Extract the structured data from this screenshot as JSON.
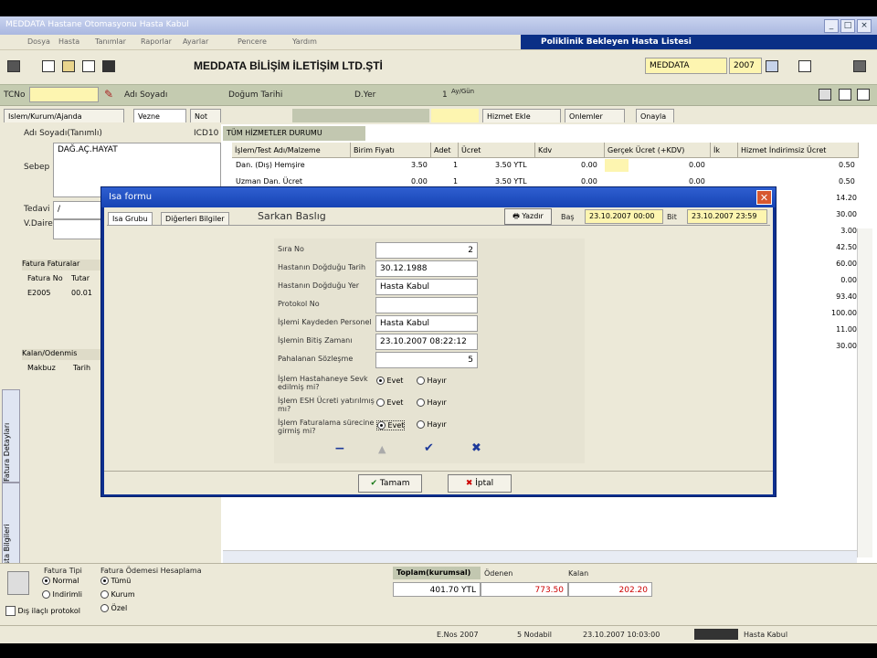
{
  "window": {
    "title": "MEDDATA Hastane Otomasyonu Hasta Kabul",
    "panel_title": "Poliklinik Bekleyen Hasta Listesi"
  },
  "menu": [
    "Dosya",
    "Hasta",
    "Tanımlar",
    "Raporlar",
    "Ayarlar",
    "Pencere",
    "Yardım"
  ],
  "toolbar": {
    "company": "MEDDATA BİLİŞİM İLETİŞİM LTD.ŞTİ",
    "db_name": "MEDDATA",
    "year": "2007"
  },
  "patientbar": {
    "tc_label": "TCNo",
    "tc_value": "",
    "name_label": "Adı Soyadı",
    "birth_label": "Doğum Tarihi",
    "age_label": "D.Yer",
    "count_label": "1",
    "count_sub": "Ay/Gün"
  },
  "tabs": {
    "main": [
      "Islem/Kurum/Ajanda",
      "Vezne",
      "Not"
    ],
    "right": [
      "Hizmet Ekle",
      "Onlemler",
      "Onayla"
    ]
  },
  "left": {
    "label_adi": "Adı Soyadı(Tanımlı)",
    "icd_label": "ICD10",
    "sebep_label": "Sebep",
    "sebep_value": "DAĞ.AÇ.HAYAT",
    "tedavi_label": "Tedavi",
    "tedavi_value": "/",
    "vdaire_label": "V.Daire",
    "fatura_header": "Fatura Faturalar",
    "fatura_cols": [
      "Fatura No",
      "Tutar"
    ],
    "fatura_row": [
      "E2005",
      "00.01"
    ],
    "bottom_header": "Kalan/Odenmis",
    "bottom_cols": [
      "Makbuz",
      "Tarih"
    ],
    "side_tabs": [
      "Fatura Detayları",
      "Hasta Bilgileri"
    ]
  },
  "grid": {
    "caption": "TÜM HİZMETLER DURUMU",
    "headers": [
      "İşlem/Test Adı/Malzeme",
      "Birim Fiyatı",
      "Adet",
      "Ücret",
      "Kdv",
      "Gerçek Ücret (+KDV)",
      "İk",
      "Hizmet İndirimsiz Ücret"
    ],
    "rows": [
      {
        "name": "Dan. (Dış) Hemşire",
        "price": "3.50",
        "qty": "1",
        "fee": "3.50 YTL",
        "kdv": "0.00",
        "real": "0.00",
        "right": "0.50"
      },
      {
        "name": "Uzman Dan. Ücret",
        "price": "0.00",
        "qty": "1",
        "fee": "3.50 YTL",
        "kdv": "0.00",
        "real": "0.00",
        "right": "0.50"
      }
    ],
    "right_values": [
      "14.20",
      "30.00",
      "3.00",
      "42.50",
      "60.00",
      "0.00",
      "93.40",
      "100.00",
      "11.00",
      "30.00"
    ]
  },
  "dialog": {
    "title": "Isa formu",
    "tabs": [
      "Isa Grubu",
      "Diğerleri Bilgiler"
    ],
    "heading": "Sarkan Baslıg",
    "tool_label": "Yazdır",
    "date_label": "Baş",
    "date_value": "23.10.2007 00:00",
    "date_label2": "Bit",
    "date_value2": "23.10.2007 23:59",
    "fields": [
      {
        "label": "Sıra No",
        "value": "2"
      },
      {
        "label": "Hastanın Doğduğu Tarih",
        "value": "30.12.1988"
      },
      {
        "label": "Hastanın Doğduğu Yer",
        "value": "Hasta Kabul"
      },
      {
        "label": "Protokol No",
        "value": ""
      },
      {
        "label": "İşlemi Kaydeden Personel",
        "value": "Hasta Kabul"
      },
      {
        "label": "İşlemin Bitiş Zamanı",
        "value": "23.10.2007 08:22:12"
      },
      {
        "label": "Pahalanan Sözleşme",
        "value": "5"
      }
    ],
    "questions": [
      {
        "label": "İşlem Hastahaneye Sevk edilmiş mi?",
        "yes": "Evet",
        "no": "Hayır",
        "selected": "yes"
      },
      {
        "label": "İşlem ESH Ücreti yatırılmış mı?",
        "yes": "Evet",
        "no": "Hayır",
        "selected": "none"
      },
      {
        "label": "İşlem Faturalama sürecine girmiş mi?",
        "yes": "Evet",
        "no": "Hayır",
        "selected": "yes"
      }
    ],
    "ok_label": "Tamam",
    "cancel_label": "İptal"
  },
  "bottom": {
    "fatura_tipi_label": "Fatura Tipi",
    "fatura_tipi_options": [
      "Normal",
      "Indirimli"
    ],
    "ozel_label": "Fatura Ödemesi Hesaplama",
    "ozel_options": [
      "Tümü",
      "Kurum",
      "Özel"
    ],
    "check_label": "Dış ilaçlı protokol",
    "totals_header": "Toplam(kurumsal)",
    "totals_cols": [
      "Ödenen",
      "Kalan"
    ],
    "totals_values": [
      "401.70 YTL",
      "773.50",
      "202.20"
    ]
  },
  "status": {
    "version": "E.Nos 2007",
    "user_code": "5 Nodabil",
    "datetime": "23.10.2007 10:03:00",
    "user": "Hasta Kabul"
  },
  "colors": {
    "dialog_title": "#1643b4",
    "panel_bar": "#0a2f86",
    "highlight": "#fdf5b0",
    "close_button": "#d7582f"
  }
}
